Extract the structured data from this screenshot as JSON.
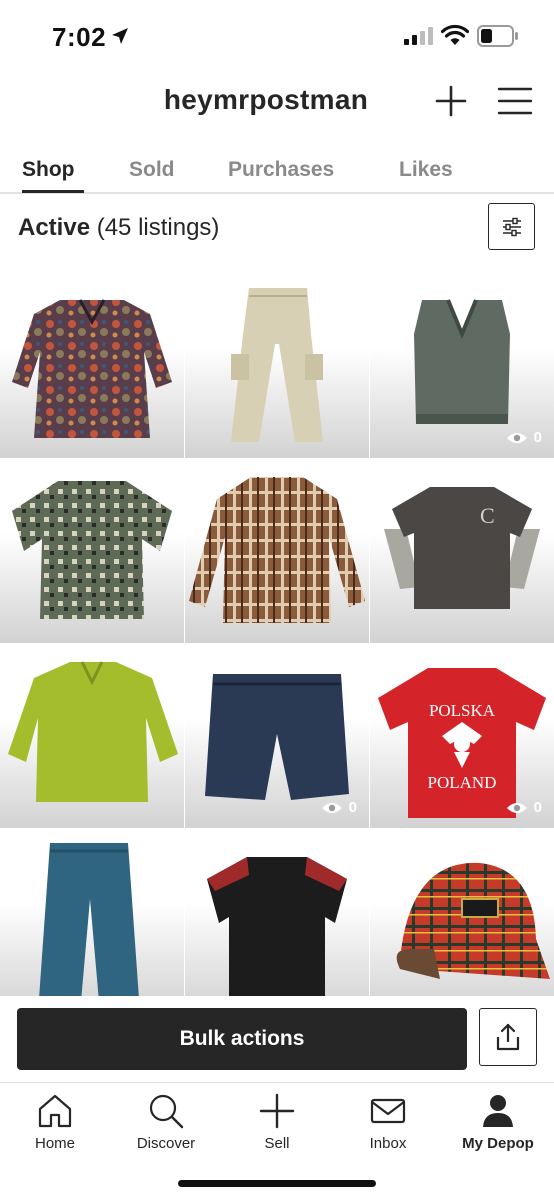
{
  "status_bar": {
    "time": "7:02",
    "icons": [
      "location-arrow-icon",
      "cellular-signal-icon",
      "wifi-icon",
      "battery-icon"
    ]
  },
  "header": {
    "username": "heymrpostman",
    "add_icon": "plus-icon",
    "menu_icon": "hamburger-menu-icon"
  },
  "tabs": [
    {
      "label": "Shop",
      "active": true
    },
    {
      "label": "Sold",
      "active": false
    },
    {
      "label": "Purchases",
      "active": false
    },
    {
      "label": "Likes",
      "active": false
    }
  ],
  "listings_summary": {
    "label": "Active",
    "count_text": "(45 listings)",
    "filter_icon": "sliders-filter-icon"
  },
  "listings": [
    {
      "item": "paisley long-sleeve tunic",
      "views": null
    },
    {
      "item": "khaki cargo pants",
      "views": null
    },
    {
      "item": "grey knit sweater vest",
      "views": "0"
    },
    {
      "item": "patterned short-sleeve button shirt",
      "views": null
    },
    {
      "item": "brown plaid flannel shirt",
      "views": null
    },
    {
      "item": "grey layered long-sleeve tee",
      "views": null
    },
    {
      "item": "lime green dress shirt",
      "views": null
    },
    {
      "item": "denim jean shorts",
      "views": "0"
    },
    {
      "item": "red POLSKA POLAND t-shirt",
      "views": "0",
      "print_top": "POLSKA",
      "print_bottom": "POLAND"
    },
    {
      "item": "blue work pants",
      "views": null
    },
    {
      "item": "black western short-sleeve shirt",
      "views": null
    },
    {
      "item": "red tartan snapback cap",
      "views": null
    }
  ],
  "actions": {
    "bulk_label": "Bulk actions",
    "share_icon": "share-icon"
  },
  "bottom_nav": [
    {
      "label": "Home",
      "icon": "home-icon",
      "current": false
    },
    {
      "label": "Discover",
      "icon": "search-icon",
      "current": false
    },
    {
      "label": "Sell",
      "icon": "plus-icon",
      "current": false
    },
    {
      "label": "Inbox",
      "icon": "mail-icon",
      "current": false
    },
    {
      "label": "My Depop",
      "icon": "person-icon",
      "current": true
    }
  ],
  "colors": {
    "text": "#262626",
    "muted_tab": "#8a8a8a",
    "button_dark": "#262626",
    "view_badge": "#ffffff"
  }
}
